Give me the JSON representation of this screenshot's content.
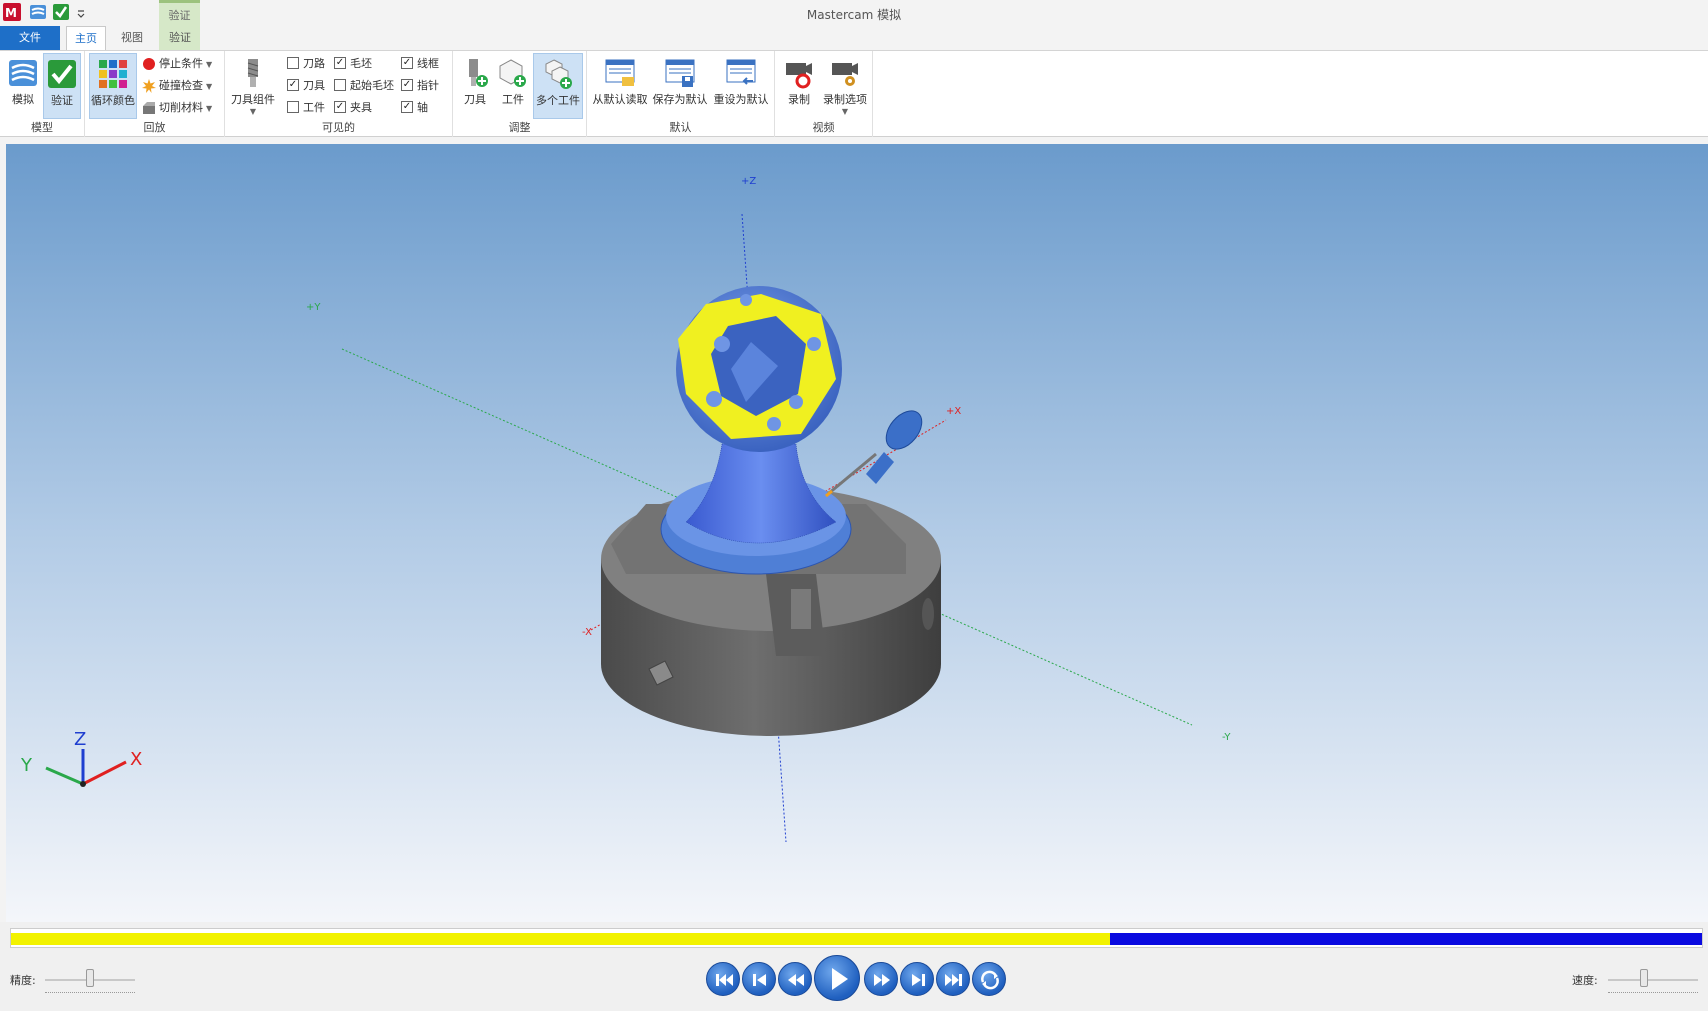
{
  "app": {
    "title": "Mastercam 模拟",
    "context_tab": "验证"
  },
  "tabs": [
    {
      "label": "文件"
    },
    {
      "label": "主页"
    },
    {
      "label": "视图"
    },
    {
      "label": "验证"
    }
  ],
  "ribbon": {
    "model": {
      "label": "模型",
      "simulate": "模拟",
      "verify": "验证"
    },
    "playback": {
      "label": "回放",
      "cycle_color": "循环颜色",
      "stop_condition": "停止条件",
      "collision_check": "碰撞检查",
      "cut_material": "切削材料"
    },
    "visible": {
      "label": "可见的",
      "tool_component": "刀具组件",
      "toolpath": "刀路",
      "tool": "刀具",
      "workpiece": "工件",
      "stock": "毛坯",
      "initial_stock": "起始毛坯",
      "fixture": "夹具",
      "wireframe": "线框",
      "pointer": "指针",
      "axis": "轴"
    },
    "adjust": {
      "label": "调整",
      "tool": "刀具",
      "workpiece": "工件",
      "multi_workpiece": "多个工件"
    },
    "default": {
      "label": "默认",
      "load_default": "从默认读取",
      "save_default": "保存为默认",
      "reset_default": "重设为默认"
    },
    "video": {
      "label": "视频",
      "record": "录制",
      "record_options": "录制选项"
    }
  },
  "viewport": {
    "axes": {
      "pz": "+Z",
      "py": "+Y",
      "px": "+X",
      "nx": "-X",
      "ny": "-Y"
    },
    "triad": {
      "x": "X",
      "y": "Y",
      "z": "Z"
    }
  },
  "checkboxes": {
    "toolpath": false,
    "tool": true,
    "workpiece": false,
    "stock": true,
    "initial_stock": false,
    "fixture": true,
    "wireframe": true,
    "pointer": true,
    "axis": true
  },
  "progress": {
    "completed_fraction": 0.65
  },
  "controls": {
    "precision_label": "精度:",
    "speed_label": "速度:",
    "precision_value": 0.5,
    "speed_value": 0.4
  },
  "colors": {
    "accent": "#1e6fc8",
    "bg_top": "#6b9bcc",
    "bg_bottom": "#f4f6fa",
    "part_blue": "#4f7fd6",
    "part_yellow": "#f0f020",
    "chuck": "#5f5f5f",
    "progress_yellow": "#f2f200",
    "progress_blue": "#0a0ae0"
  }
}
